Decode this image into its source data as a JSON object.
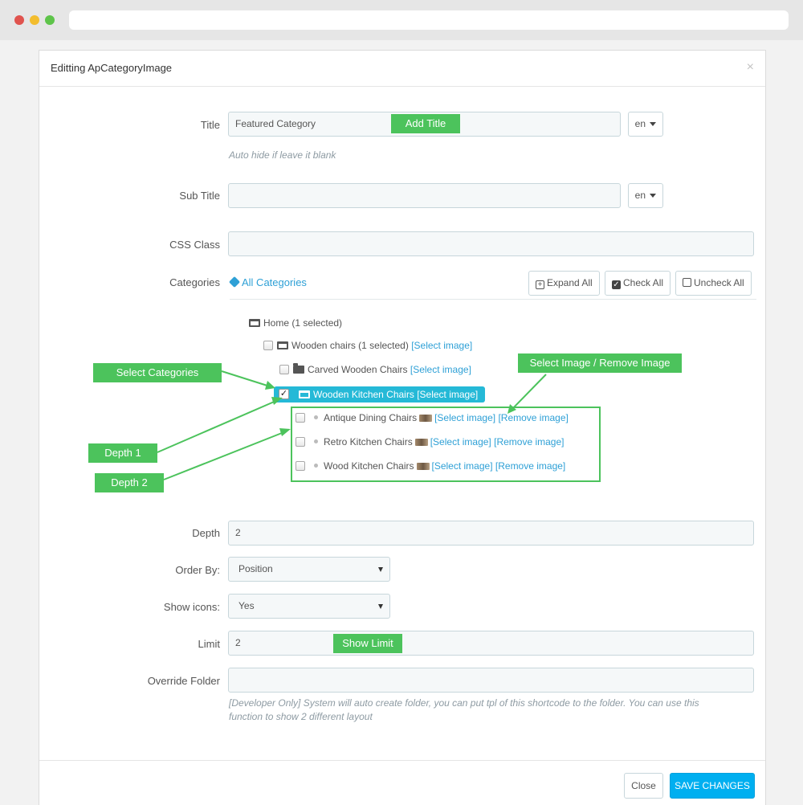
{
  "modal": {
    "title": "Editting ApCategoryImage",
    "close_glyph": "×"
  },
  "form": {
    "title_label": "Title",
    "title_value": "Featured Category",
    "lang_label": "en",
    "title_help": "Auto hide if leave it blank",
    "subtitle_label": "Sub Title",
    "subtitle_value": "",
    "css_label": "CSS Class",
    "css_value": "",
    "categories_label": "Categories",
    "all_categories": "All Categories",
    "expand_all": "Expand All",
    "check_all": "Check All",
    "uncheck_all": "Uncheck All",
    "depth_label": "Depth",
    "depth_value": "2",
    "order_label": "Order By:",
    "order_value": "Position",
    "show_icons_label": "Show icons:",
    "show_icons_value": "Yes",
    "limit_label": "Limit",
    "limit_value": "2",
    "override_label": "Override Folder",
    "override_value": "",
    "override_help_1": "[Developer Only] System will auto create folder, you can put tpl of this shortcode to the folder. You can use this",
    "override_help_2": "function to show 2 different layout"
  },
  "tree": {
    "home": "Home (1 selected)",
    "wooden_chairs": "Wooden chairs (1 selected)",
    "carved": "Carved Wooden Chairs",
    "kitchen": "Wooden Kitchen Chairs",
    "antique": "Antique Dining Chairs",
    "retro": "Retro Kitchen Chairs",
    "wood": "Wood Kitchen Chairs",
    "select_image": "[Select image]",
    "remove_image": "[Remove image]"
  },
  "annotations": {
    "add_title": "Add Title",
    "select_categories": "Select Categories",
    "select_remove_image": "Select Image / Remove Image",
    "depth1": "Depth 1",
    "depth2": "Depth 2",
    "show_limit": "Show Limit"
  },
  "footer": {
    "close": "Close",
    "save": "SAVE CHANGES"
  },
  "colors": {
    "accent": "#25b9d7",
    "annotation": "#4cc35c",
    "save": "#00aff0",
    "link": "#2ea0d6"
  }
}
